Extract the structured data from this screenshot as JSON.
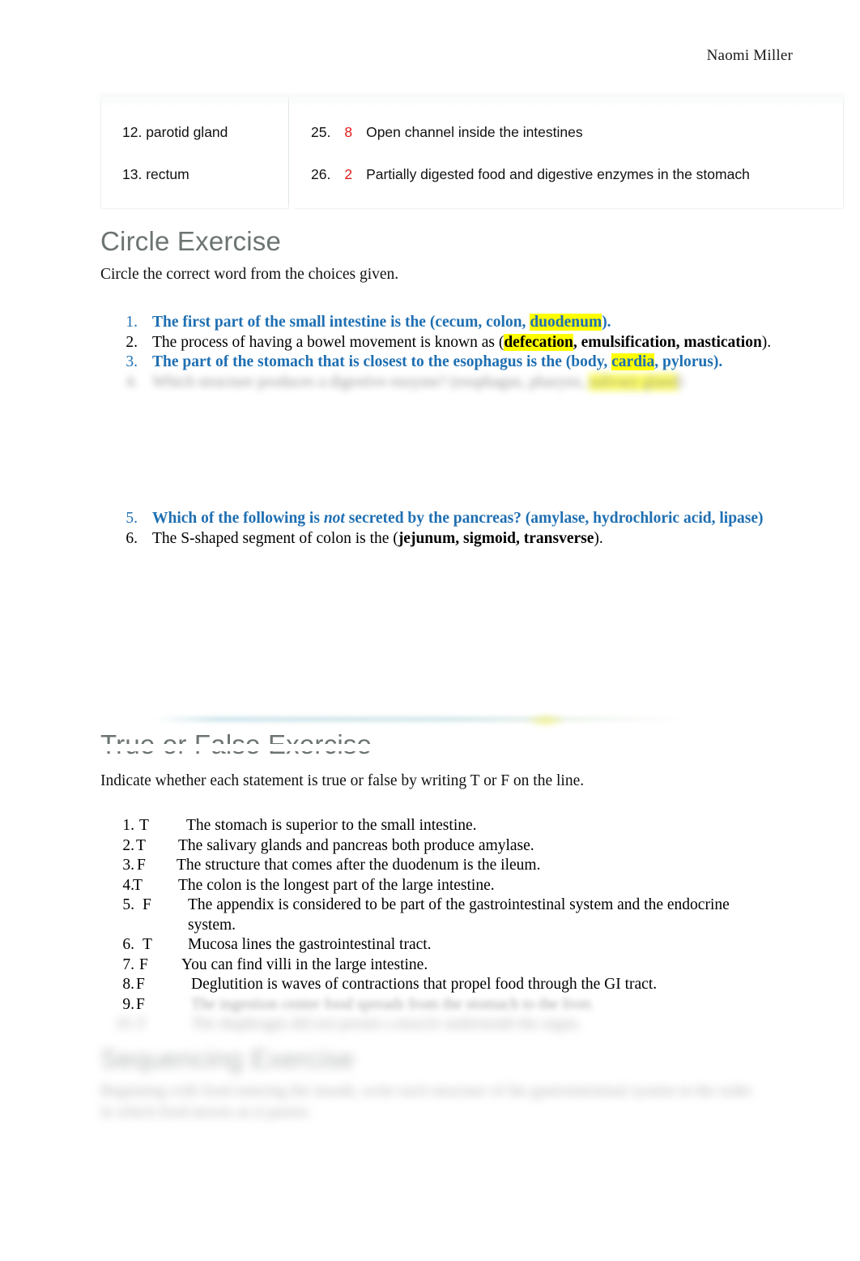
{
  "header": {
    "student_name": "Naomi Miller"
  },
  "matching_table": {
    "left_column": [
      {
        "number": "12.",
        "term": "parotid gland"
      },
      {
        "number": "13.",
        "term": "rectum"
      }
    ],
    "right_column": [
      {
        "number": "25.",
        "answer": "8",
        "definition": "Open channel inside the intestines"
      },
      {
        "number": "26.",
        "answer": "2",
        "definition": "Partially digested food and digestive enzymes in the stomach"
      }
    ],
    "answer_color": "#e01b1b"
  },
  "circle_exercise": {
    "heading": "Circle Exercise",
    "intro": "Circle the correct word from the choices given.",
    "items": [
      {
        "number": "1.",
        "style": "blue-bold",
        "pre": "The first part of the small intestine is the (cecum, colon, ",
        "highlight": "duodenum",
        "post": ")."
      },
      {
        "number": "2.",
        "style": "black",
        "pre": "The process of having a bowel movement is known as (",
        "highlight": "defecation",
        "mid": ", emulsification, mastication",
        "post": ")."
      },
      {
        "number": "3.",
        "style": "blue-bold",
        "pre": "The part of the stomach that is closest to the esophagus is the (body, ",
        "highlight": "cardia",
        "post": ", pylorus)."
      },
      {
        "number": "4.",
        "style": "blurred",
        "pre": "Which structure produces a digestive enzyme? (esophagus, pharynx, ",
        "highlight": "salivary gland",
        "post": ")"
      },
      {
        "number": "5.",
        "style": "blue-bold",
        "pre_plain": "Which of the following is ",
        "italic": "not",
        "post_plain": " secreted by the pancreas? (amylase, hydrochloric acid, lipase)"
      },
      {
        "number": "6.",
        "style": "black",
        "pre": "The S-shaped segment of colon is the (",
        "bold": "jejunum, sigmoid, transverse",
        "post": ")."
      }
    ],
    "blue_color": "#1f6fb2",
    "highlight_color": "#ffff00"
  },
  "true_false_exercise": {
    "heading": "True or False Exercise",
    "intro": "Indicate whether each statement is true or false by writing T or F on the line.",
    "items": [
      {
        "number": "1.",
        "answer": "T",
        "statement": "The stomach is superior to the small intestine."
      },
      {
        "number": "2.",
        "answer": "T",
        "statement": "The salivary glands and pancreas both produce amylase."
      },
      {
        "number": "3.",
        "answer": "F",
        "statement": "The structure that comes after the duodenum is the ileum."
      },
      {
        "number": "4.",
        "answer": "T",
        "statement": "The colon is the longest part of the large intestine."
      },
      {
        "number": "5.",
        "answer": "F",
        "statement": "The appendix is considered to be part of the gastrointestinal system and the endocrine system."
      },
      {
        "number": "6.",
        "answer": "T",
        "statement": "Mucosa lines the gastrointestinal tract."
      },
      {
        "number": "7.",
        "answer": "F",
        "statement": "You can find villi in the large intestine."
      },
      {
        "number": "8.",
        "answer": "F",
        "statement": "Deglutition is waves of contractions that propel food through the GI tract."
      },
      {
        "number": "9.",
        "answer": "F",
        "statement": "The ingestion center food spreads from the stomach to the liver."
      },
      {
        "number": "10.",
        "answer": "F",
        "statement": "The diaphragm did not permit a muscle underneath the organ."
      }
    ]
  },
  "sequencing_exercise": {
    "heading": "Sequencing Exercise",
    "intro": "Beginning with food entering the mouth, write each structure of the gastrointestinal system in the order in which food moves as it passes."
  }
}
